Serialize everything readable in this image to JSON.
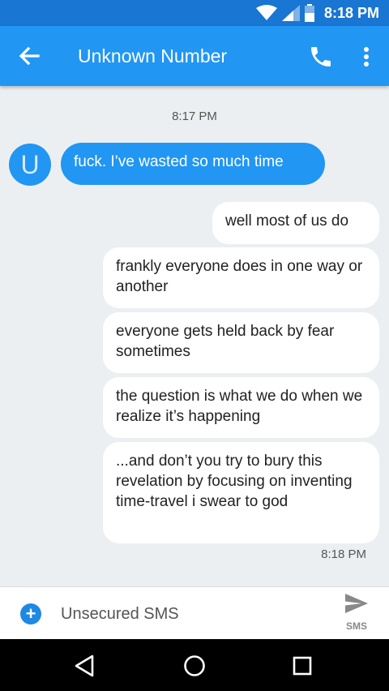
{
  "status_bar": {
    "time": "8:18 PM",
    "icons": [
      "wifi-icon",
      "signal-icon",
      "battery-icon"
    ]
  },
  "app_bar": {
    "title": "Unknown Number",
    "icons": [
      "back-arrow-icon",
      "phone-icon",
      "more-vert-icon"
    ]
  },
  "conversation": {
    "timestamp_top": "8:17 PM",
    "avatar_letter": "U",
    "incoming": [
      "fuck. I’ve wasted so much time"
    ],
    "outgoing": [
      "well most of us do",
      "frankly everyone does in one way or another",
      "everyone gets held back by fear sometimes",
      "the question is what we do when we realize it’s happening",
      "...and don’t you try to bury this revelation by focusing on inventing time-travel i swear to god"
    ],
    "timestamp_bottom": "8:18 PM"
  },
  "compose": {
    "placeholder": "Unsecured SMS",
    "send_label": "SMS"
  },
  "nav_bar": {
    "icons": [
      "back-triangle-icon",
      "home-circle-icon",
      "recents-square-icon"
    ]
  },
  "colors": {
    "status_bar": "#1976D2",
    "app_bar": "#2196F3",
    "incoming_bubble": "#2196F3",
    "outgoing_bubble": "#FFFFFF",
    "background": "#ECEFF1"
  }
}
